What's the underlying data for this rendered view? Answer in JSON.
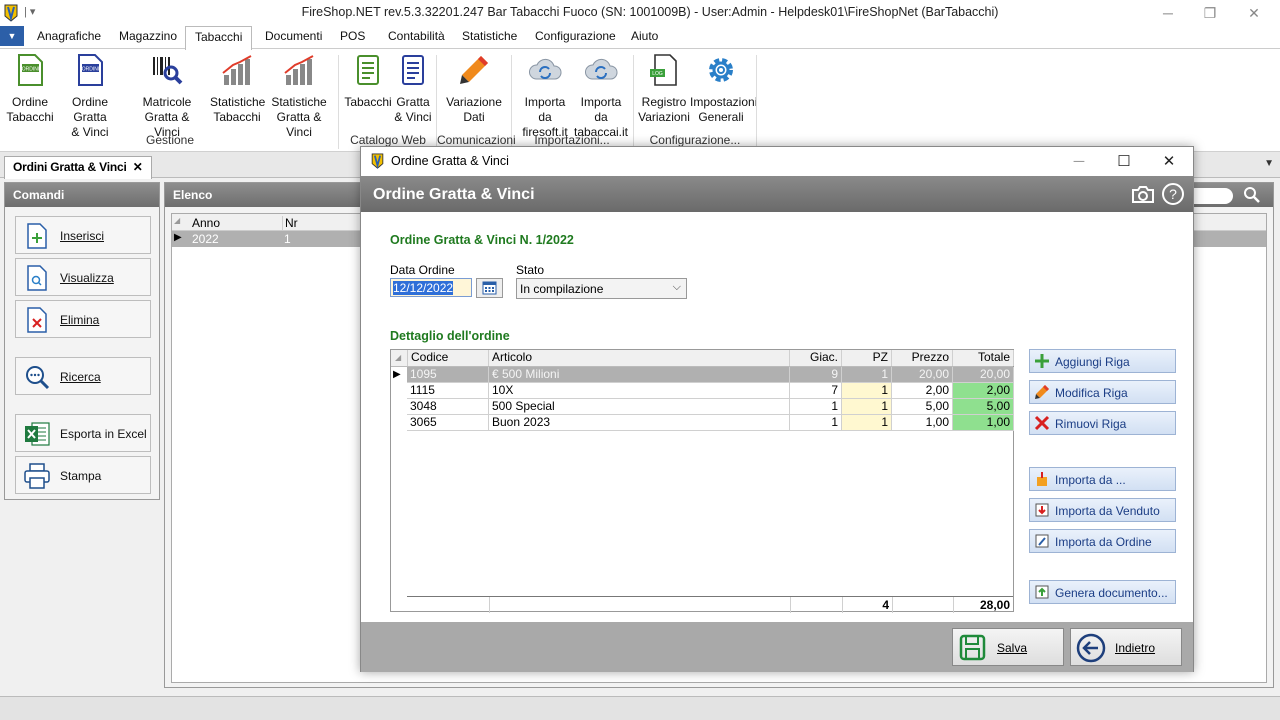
{
  "window": {
    "title": "FireShop.NET rev.5.3.32201.247 Bar Tabacchi Fuoco (SN: 1001009B) - User:Admin - Helpdesk01\\FireShopNet (BarTabacchi)"
  },
  "ribbon_tabs": [
    {
      "label": "Anagrafiche"
    },
    {
      "label": "Magazzino"
    },
    {
      "label": "Tabacchi",
      "active": true
    },
    {
      "label": "Documenti"
    },
    {
      "label": "POS"
    },
    {
      "label": "Contabilità"
    },
    {
      "label": "Statistiche"
    },
    {
      "label": "Configurazione"
    },
    {
      "label": "Aiuto"
    }
  ],
  "ribbon": {
    "buttons": [
      {
        "line1": "Ordine",
        "line2": "Tabacchi",
        "icon": "ordini-tabacchi-icon"
      },
      {
        "line1": "Ordine Gratta",
        "line2": "& Vinci",
        "icon": "ordini-gratta-icon"
      },
      {
        "line1": "Matricole",
        "line2": "Gratta & Vinci",
        "icon": "barcode-search-icon"
      },
      {
        "line1": "Statistiche",
        "line2": "Tabacchi",
        "icon": "bar-chart-icon"
      },
      {
        "line1": "Statistiche",
        "line2": "Gratta & Vinci",
        "icon": "bar-chart-icon"
      },
      {
        "line1": "Tabacchi",
        "line2": "",
        "icon": "catalog-icon"
      },
      {
        "line1": "Gratta",
        "line2": "& Vinci",
        "icon": "catalog-icon"
      },
      {
        "line1": "Variazione",
        "line2": "Dati",
        "icon": "pencil-icon"
      },
      {
        "line1": "Importa da",
        "line2": "firesoft.it",
        "icon": "cloud-sync-icon"
      },
      {
        "line1": "Importa da",
        "line2": "tabaccai.it",
        "icon": "cloud-sync-icon"
      },
      {
        "line1": "Registro",
        "line2": "Variazioni",
        "icon": "log-document-icon"
      },
      {
        "line1": "Impostazioni",
        "line2": "Generali",
        "icon": "gear-icon"
      }
    ],
    "groups": [
      "Gestione",
      "Catalogo Web",
      "Comunicazioni",
      "Importazioni...",
      "Configurazione..."
    ]
  },
  "doc_tab": {
    "label": "Ordini Gratta & Vinci",
    "close": "✕"
  },
  "commands": {
    "title": "Comandi",
    "buttons": [
      {
        "label": "Inserisci",
        "icon": "insert-document-icon"
      },
      {
        "label": "Visualizza",
        "icon": "view-document-icon"
      },
      {
        "label": "Elimina",
        "icon": "delete-document-icon"
      },
      {
        "label": "Ricerca",
        "icon": "search-icon"
      },
      {
        "label": "Esporta in Excel",
        "icon": "excel-icon"
      },
      {
        "label": "Stampa",
        "icon": "printer-icon"
      }
    ]
  },
  "elenco": {
    "title": "Elenco",
    "columns": [
      "Anno",
      "Nr"
    ],
    "rows": [
      {
        "anno": "2022",
        "nr": "1"
      }
    ]
  },
  "dialog": {
    "window_title": "Ordine Gratta & Vinci",
    "header": "Ordine Gratta & Vinci",
    "subtitle": "Ordine Gratta & Vinci N. 1/2022",
    "date_label": "Data Ordine",
    "date_value": "12/12/2022",
    "status_label": "Stato",
    "status_value": "In compilazione",
    "detail_title": "Dettaglio dell'ordine",
    "columns": [
      "Codice",
      "Articolo",
      "Giac.",
      "PZ",
      "Prezzo",
      "Totale"
    ],
    "rows": [
      {
        "codice": "1095",
        "articolo": "€ 500 Milioni",
        "giac": "9",
        "pz": "1",
        "prezzo": "20,00",
        "totale": "20,00"
      },
      {
        "codice": "1115",
        "articolo": "10X",
        "giac": "7",
        "pz": "1",
        "prezzo": "2,00",
        "totale": "2,00"
      },
      {
        "codice": "3048",
        "articolo": "500 Special",
        "giac": "1",
        "pz": "1",
        "prezzo": "5,00",
        "totale": "5,00"
      },
      {
        "codice": "3065",
        "articolo": "Buon 2023",
        "giac": "1",
        "pz": "1",
        "prezzo": "1,00",
        "totale": "1,00"
      }
    ],
    "total_pz": "4",
    "total_amount": "28,00",
    "side_buttons": [
      {
        "label": "Aggiungi Riga",
        "icon": "plus-icon"
      },
      {
        "label": "Modifica Riga",
        "icon": "pencil-icon"
      },
      {
        "label": "Rimuovi Riga",
        "icon": "x-icon"
      },
      {
        "label": "Importa da ...",
        "icon": "import-icon"
      },
      {
        "label": "Importa da Venduto",
        "icon": "import-down-icon"
      },
      {
        "label": "Importa da Ordine",
        "icon": "import-edit-icon"
      },
      {
        "label": "Genera documento...",
        "icon": "generate-icon"
      }
    ],
    "save_label": "Salva",
    "back_label": "Indietro"
  }
}
